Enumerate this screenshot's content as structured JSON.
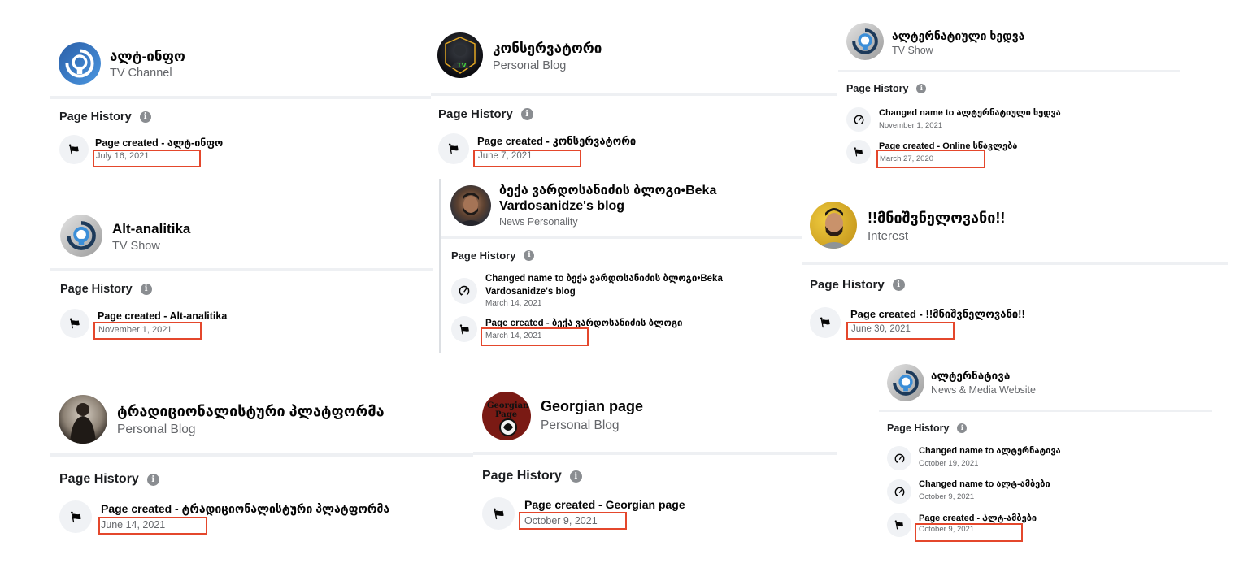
{
  "section_label": "Page History",
  "panels": [
    {
      "name": "ალტ-ინფო",
      "category": "TV Channel",
      "entries": [
        {
          "type": "created",
          "text": "Page created - ალტ-ინფო",
          "date": "July 16, 2021",
          "highlighted": true
        }
      ]
    },
    {
      "name": "კონსერვატორი",
      "category": "Personal Blog",
      "entries": [
        {
          "type": "created",
          "text": "Page created - კონსერვატორი",
          "date": "June 7, 2021",
          "highlighted": true
        }
      ]
    },
    {
      "name": "ალტერნატიული ხედვა",
      "category": "TV Show",
      "entries": [
        {
          "type": "renamed",
          "text": "Changed name to ალტერნატიული ხედვა",
          "date": "November 1, 2021",
          "highlighted": false
        },
        {
          "type": "created",
          "text": "Page created - Online სწავლება",
          "date": "March 27, 2020",
          "highlighted": true
        }
      ]
    },
    {
      "name": "Alt-analitika",
      "category": "TV Show",
      "entries": [
        {
          "type": "created",
          "text": "Page created - Alt-analitika",
          "date": "November 1, 2021",
          "highlighted": true
        }
      ]
    },
    {
      "name": "ბექა ვარდოსანიძის ბლოგი•Beka Vardosanidze's blog",
      "category": "News Personality",
      "entries": [
        {
          "type": "renamed",
          "text": "Changed name to ბექა ვარდოსანიძის ბლოგი•Beka Vardosanidze's blog",
          "date": "March 14, 2021",
          "highlighted": false
        },
        {
          "type": "created",
          "text": "Page created - ბექა ვარდოსანიძის ბლოგი",
          "date": "March 14, 2021",
          "highlighted": true
        }
      ]
    },
    {
      "name": "!!მნიშვნელოვანი!!",
      "category": "Interest",
      "entries": [
        {
          "type": "created",
          "text": "Page created - !!მნიშვნელოვანი!!",
          "date": "June 30, 2021",
          "highlighted": true
        }
      ]
    },
    {
      "name": "ტრადიციონალისტური პლატფორმა",
      "category": "Personal Blog",
      "entries": [
        {
          "type": "created",
          "text": "Page created - ტრადიციონალისტური პლატფორმა",
          "date": "June 14, 2021",
          "highlighted": true
        }
      ]
    },
    {
      "name": "Georgian page",
      "category": "Personal Blog",
      "entries": [
        {
          "type": "created",
          "text": "Page created - Georgian page",
          "date": "October 9, 2021",
          "highlighted": true
        }
      ]
    },
    {
      "name": "ალტერნატივა",
      "category": "News & Media Website",
      "entries": [
        {
          "type": "renamed",
          "text": "Changed name to ალტერნატივა",
          "date": "October 19, 2021",
          "highlighted": false
        },
        {
          "type": "renamed",
          "text": "Changed name to ალტ-ამბები",
          "date": "October 9, 2021",
          "highlighted": false
        },
        {
          "type": "created",
          "text": "Page created - Ალტ-ამბები",
          "date": "October 9, 2021",
          "highlighted": true
        }
      ]
    }
  ],
  "icons": {
    "created": "flag-icon",
    "renamed": "name-change-icon",
    "info": "info-icon"
  },
  "colors": {
    "highlight": "#e4472c",
    "secondary_text": "#65676b",
    "icon_bg": "#f0f2f5",
    "separator": "#eef0f3"
  }
}
